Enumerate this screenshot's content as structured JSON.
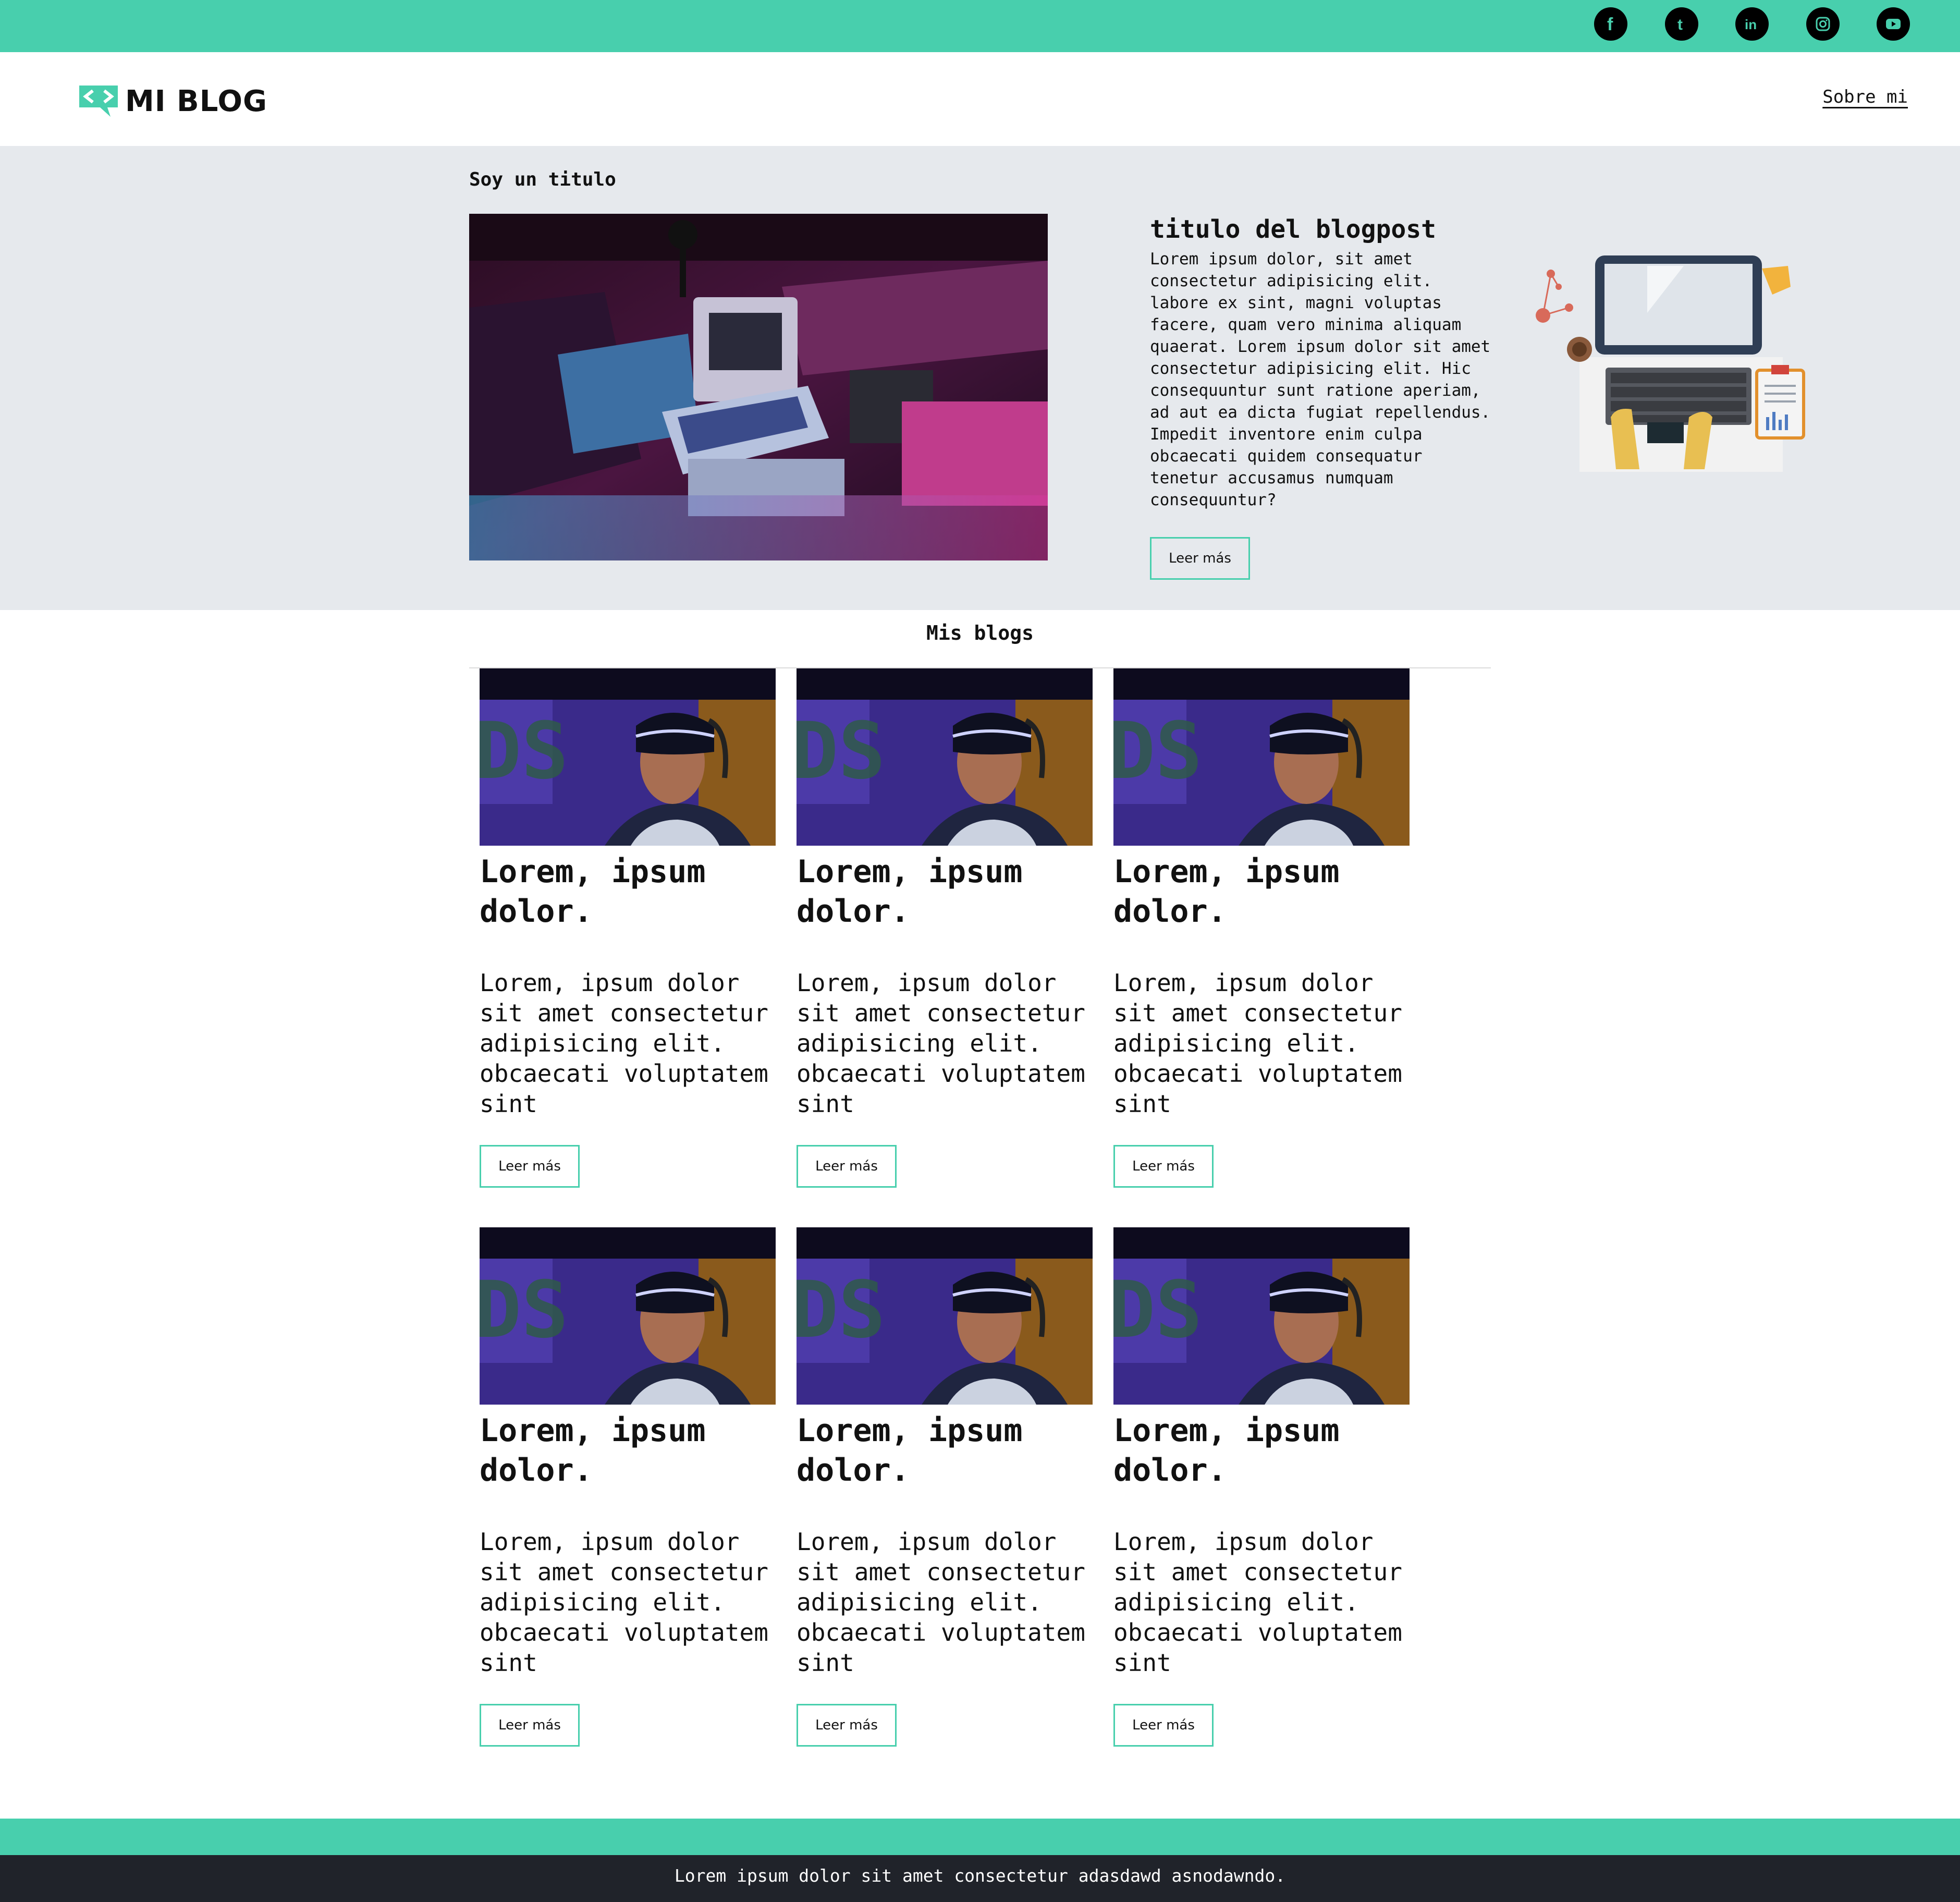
{
  "social": {
    "items": [
      {
        "name": "facebook",
        "glyph": "f"
      },
      {
        "name": "tumblr",
        "glyph": "t"
      },
      {
        "name": "linkedin",
        "glyph": "in"
      },
      {
        "name": "instagram",
        "glyph": ""
      },
      {
        "name": "youtube",
        "glyph": ""
      }
    ]
  },
  "header": {
    "logo_text": "MI BLOG",
    "nav_link": "Sobre mi"
  },
  "hero": {
    "section_title": "Soy un titulo",
    "post_title": "titulo del blogpost",
    "post_text": "Lorem ipsum dolor, sit amet consectetur adipisicing elit. labore ex sint, magni voluptas facere, quam vero minima aliquam quaerat. Lorem ipsum dolor sit amet consectetur adipisicing elit. Hic consequuntur sunt ratione aperiam, ad aut ea dicta fugiat repellendus. Impedit inventore enim culpa obcaecati quidem consequatur tenetur accusamus numquam consequuntur?",
    "button": "Leer más"
  },
  "blogs": {
    "heading": "Mis blogs",
    "cards": [
      {
        "title": "Lorem, ipsum dolor.",
        "text": "Lorem, ipsum dolor sit amet consectetur adipisicing elit. obcaecati voluptatem sint",
        "button": "Leer más"
      },
      {
        "title": "Lorem, ipsum dolor.",
        "text": "Lorem, ipsum dolor sit amet consectetur adipisicing elit. obcaecati voluptatem sint",
        "button": "Leer más"
      },
      {
        "title": "Lorem, ipsum dolor.",
        "text": "Lorem, ipsum dolor sit amet consectetur adipisicing elit. obcaecati voluptatem sint",
        "button": "Leer más"
      },
      {
        "title": "Lorem, ipsum dolor.",
        "text": "Lorem, ipsum dolor sit amet consectetur adipisicing elit. obcaecati voluptatem sint",
        "button": "Leer más"
      },
      {
        "title": "Lorem, ipsum dolor.",
        "text": "Lorem, ipsum dolor sit amet consectetur adipisicing elit. obcaecati voluptatem sint",
        "button": "Leer más"
      },
      {
        "title": "Lorem, ipsum dolor.",
        "text": "Lorem, ipsum dolor sit amet consectetur adipisicing elit. obcaecati voluptatem sint",
        "button": "Leer más"
      }
    ]
  },
  "footer": {
    "text": "Lorem ipsum dolor sit amet consectetur adasdawd asnodawndo."
  },
  "colors": {
    "accent": "#48cfad",
    "hero_bg": "#e6e9ed",
    "footer_bg": "#20232a"
  }
}
